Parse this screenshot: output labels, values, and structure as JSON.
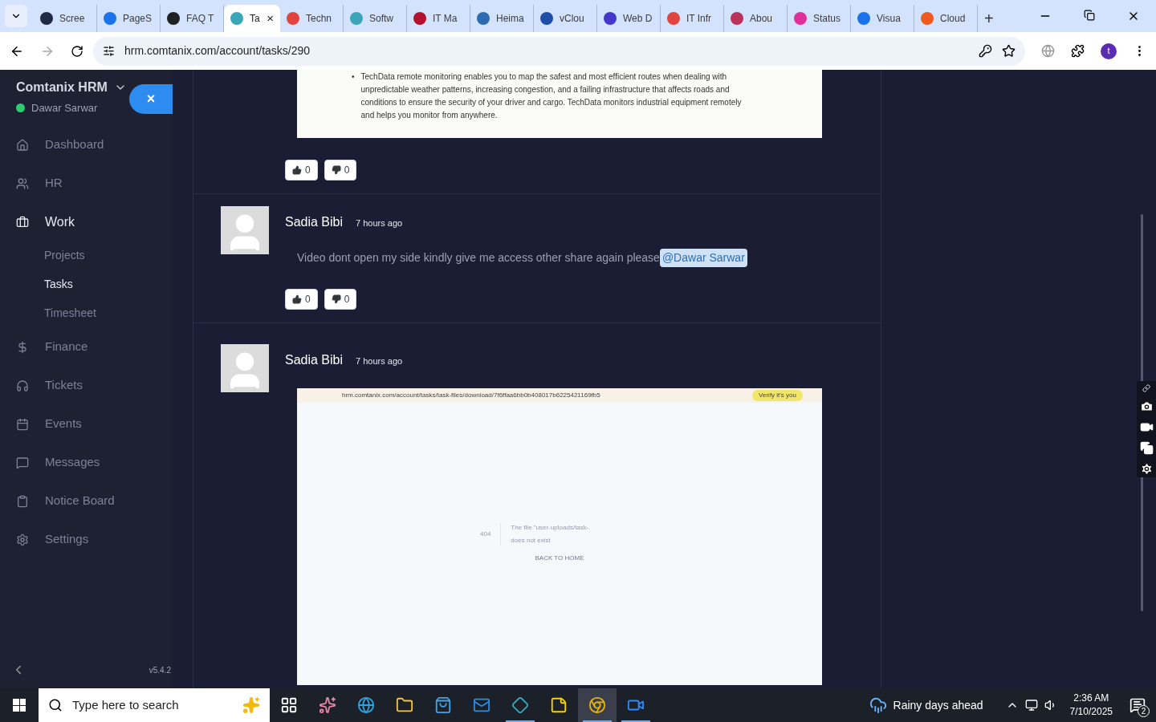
{
  "browser": {
    "tabs": [
      {
        "title": "Scree",
        "selected": false,
        "color": "#1f2a44"
      },
      {
        "title": "PageS",
        "selected": false,
        "color": "#1a73e8"
      },
      {
        "title": "FAQ T",
        "selected": false,
        "color": "#202124"
      },
      {
        "title": "Ta",
        "selected": true,
        "color": "#3aa6b9"
      },
      {
        "title": "Techn",
        "selected": false,
        "color": "#e0443e"
      },
      {
        "title": "Softw",
        "selected": false,
        "color": "#3aa6b9"
      },
      {
        "title": "IT Ma",
        "selected": false,
        "color": "#b3122e"
      },
      {
        "title": "Heima",
        "selected": false,
        "color": "#2b6cb0"
      },
      {
        "title": "vClou",
        "selected": false,
        "color": "#1e4fa8"
      },
      {
        "title": "Web D",
        "selected": false,
        "color": "#4338ca"
      },
      {
        "title": "IT Infr",
        "selected": false,
        "color": "#e0443e"
      },
      {
        "title": "Abou",
        "selected": false,
        "color": "#b8325a"
      },
      {
        "title": "Status",
        "selected": false,
        "color": "#e0309a"
      },
      {
        "title": "Visua",
        "selected": false,
        "color": "#1a73e8"
      },
      {
        "title": "Cloud",
        "selected": false,
        "color": "#f0591f"
      }
    ],
    "close_tab": "×",
    "new_tab": "+",
    "url": "hrm.comtanix.com/account/tasks/290",
    "profile": "t"
  },
  "sidebar": {
    "app_name": "Comtanix HRM",
    "user": "Dawar Sarwar",
    "online": true,
    "close_button": "×",
    "items": [
      {
        "label": "Dashboard",
        "expanded": false
      },
      {
        "label": "HR",
        "expanded": false
      },
      {
        "label": "Work",
        "expanded": true,
        "children": [
          {
            "label": "Projects",
            "selected": false
          },
          {
            "label": "Tasks",
            "selected": true
          },
          {
            "label": "Timesheet",
            "selected": false
          }
        ]
      },
      {
        "label": "Finance",
        "expanded": false
      },
      {
        "label": "Tickets",
        "expanded": false
      },
      {
        "label": "Events",
        "expanded": false
      },
      {
        "label": "Messages",
        "expanded": false
      },
      {
        "label": "Notice Board",
        "expanded": false
      },
      {
        "label": "Settings",
        "expanded": false
      }
    ],
    "version": "v5.4.2"
  },
  "comments": [
    {
      "kind": "image_only",
      "bullet": "•",
      "image_text": "TechData remote monitoring enables you to map the safest and most efficient routes when dealing with unpredictable weather patterns, increasing congestion, and a failing infrastructure that affects roads and conditions to ensure the security of your driver and cargo. TechData monitors industrial equipment remotely and helps you monitor from anywhere.",
      "likes": "0",
      "dislikes": "0"
    },
    {
      "kind": "text",
      "author": "Sadia Bibi",
      "time": "7 hours ago",
      "text": "Video dont open my side kindly give me access other share again please",
      "mention": "@Dawar Sarwar",
      "likes": "0",
      "dislikes": "0"
    },
    {
      "kind": "screenshot",
      "author": "Sadia Bibi",
      "time": "7 hours ago",
      "screenshot": {
        "url": "hrm.comtanix.com/account/tasks/task-files/download/7f6ffaa6bb0b408017b6225421169fb5",
        "verify": "Verify it's you",
        "code": "404",
        "message_start": "The file \"user-uploads/task-",
        "message_end": "does not exist",
        "back": "BACK TO HOME"
      }
    }
  ],
  "taskbar": {
    "search_placeholder": "Type here to search",
    "apps": [
      {
        "running": false,
        "selected": false
      },
      {
        "running": false,
        "selected": false
      },
      {
        "running": false,
        "selected": false
      },
      {
        "running": false,
        "selected": false
      },
      {
        "running": false,
        "selected": false
      },
      {
        "running": false,
        "selected": false
      },
      {
        "running": true,
        "selected": false
      },
      {
        "running": false,
        "selected": false
      },
      {
        "running": true,
        "selected": true
      },
      {
        "running": true,
        "selected": false
      }
    ],
    "weather": "Rainy days ahead",
    "time": "2:36 AM",
    "date": "7/10/2025",
    "notifications": "2"
  }
}
